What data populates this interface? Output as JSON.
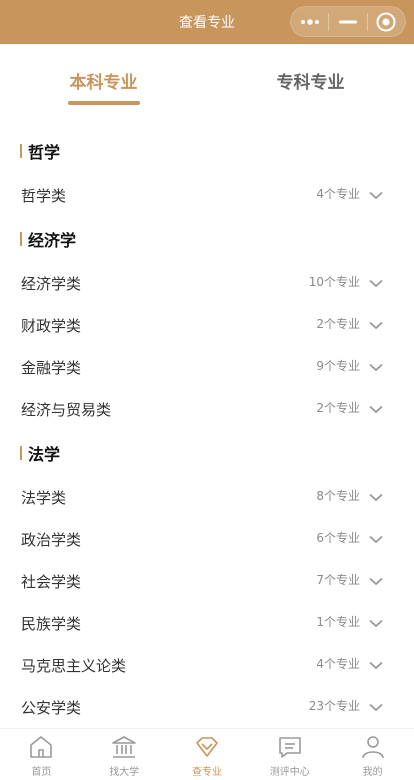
{
  "navbar": {
    "title": "查看专业"
  },
  "tabs": [
    {
      "label": "本科专业",
      "active": true
    },
    {
      "label": "专科专业",
      "active": false
    }
  ],
  "sections": [
    {
      "title": "哲学",
      "items": [
        {
          "name": "哲学类",
          "count": "4个专业"
        }
      ]
    },
    {
      "title": "经济学",
      "items": [
        {
          "name": "经济学类",
          "count": "10个专业"
        },
        {
          "name": "财政学类",
          "count": "2个专业"
        },
        {
          "name": "金融学类",
          "count": "9个专业"
        },
        {
          "name": "经济与贸易类",
          "count": "2个专业"
        }
      ]
    },
    {
      "title": "法学",
      "items": [
        {
          "name": "法学类",
          "count": "8个专业"
        },
        {
          "name": "政治学类",
          "count": "6个专业"
        },
        {
          "name": "社会学类",
          "count": "7个专业"
        },
        {
          "name": "民族学类",
          "count": "1个专业"
        },
        {
          "name": "马克思主义论类",
          "count": "4个专业"
        },
        {
          "name": "公安学类",
          "count": "23个专业"
        }
      ]
    }
  ],
  "tabbar": [
    {
      "label": "首页",
      "icon": "home-icon",
      "active": false
    },
    {
      "label": "找大学",
      "icon": "university-icon",
      "active": false
    },
    {
      "label": "查专业",
      "icon": "diamond-icon",
      "active": true
    },
    {
      "label": "测评中心",
      "icon": "message-icon",
      "active": false
    },
    {
      "label": "我的",
      "icon": "user-icon",
      "active": false
    }
  ],
  "colors": {
    "accent": "#c8955c",
    "text": "#333333",
    "muted": "#8a8a8a"
  }
}
